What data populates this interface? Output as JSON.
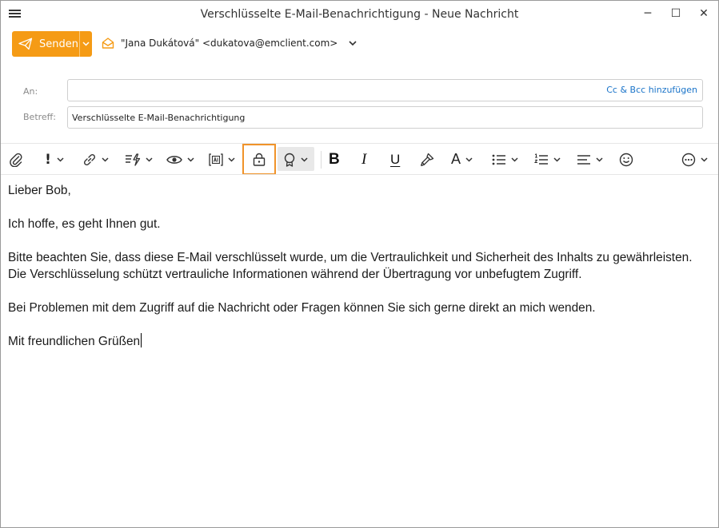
{
  "window": {
    "title": "Verschlüsselte E-Mail-Benachrichtigung - Neue Nachricht",
    "minimize_glyph": "─",
    "maximize_glyph": "☐",
    "close_glyph": "✕"
  },
  "send": {
    "label": "Senden",
    "icon": "paper-plane-icon"
  },
  "from": {
    "value": "\"Jana Dukátová\" <dukatova@emclient.com>",
    "icon": "envelope-open-icon"
  },
  "fields": {
    "to_label": "An:",
    "to_value": "",
    "cc_bcc_label": "Cc & Bcc hinzufügen",
    "subject_label": "Betreff:",
    "subject_value": "Verschlüsselte E-Mail-Benachrichtigung"
  },
  "toolbar": {
    "items": [
      "attach-icon",
      "priority-icon",
      "link-icon",
      "quick-text-icon",
      "read-receipt-icon",
      "template-icon",
      "encrypt-lock-icon",
      "sign-icon",
      "bold-icon",
      "italic-icon",
      "underline-icon",
      "format-painter-icon",
      "font-icon",
      "bullet-list-icon",
      "numbered-list-icon",
      "align-icon",
      "emoji-icon",
      "more-icon"
    ],
    "bold_glyph": "B",
    "italic_glyph": "I",
    "underline_glyph": "U",
    "font_glyph": "A",
    "priority_glyph": "!",
    "highlight_color": "#f0932a"
  },
  "body": {
    "greeting": "Lieber Bob,",
    "line1": "Ich hoffe, es geht Ihnen gut.",
    "para2_line1": "Bitte beachten Sie, dass diese E-Mail verschlüsselt wurde, um die Vertraulichkeit und Sicherheit des Inhalts zu gewährleisten.",
    "para2_line2": "Die Verschlüsselung schützt vertrauliche Informationen während der Übertragung vor unbefugtem Zugriff.",
    "para3": "Bei Problemen mit dem Zugriff auf die Nachricht oder Fragen können Sie sich gerne direkt an mich wenden.",
    "closing": "Mit freundlichen Grüßen"
  },
  "colors": {
    "accent": "#f59b15",
    "link": "#1a74c9"
  }
}
